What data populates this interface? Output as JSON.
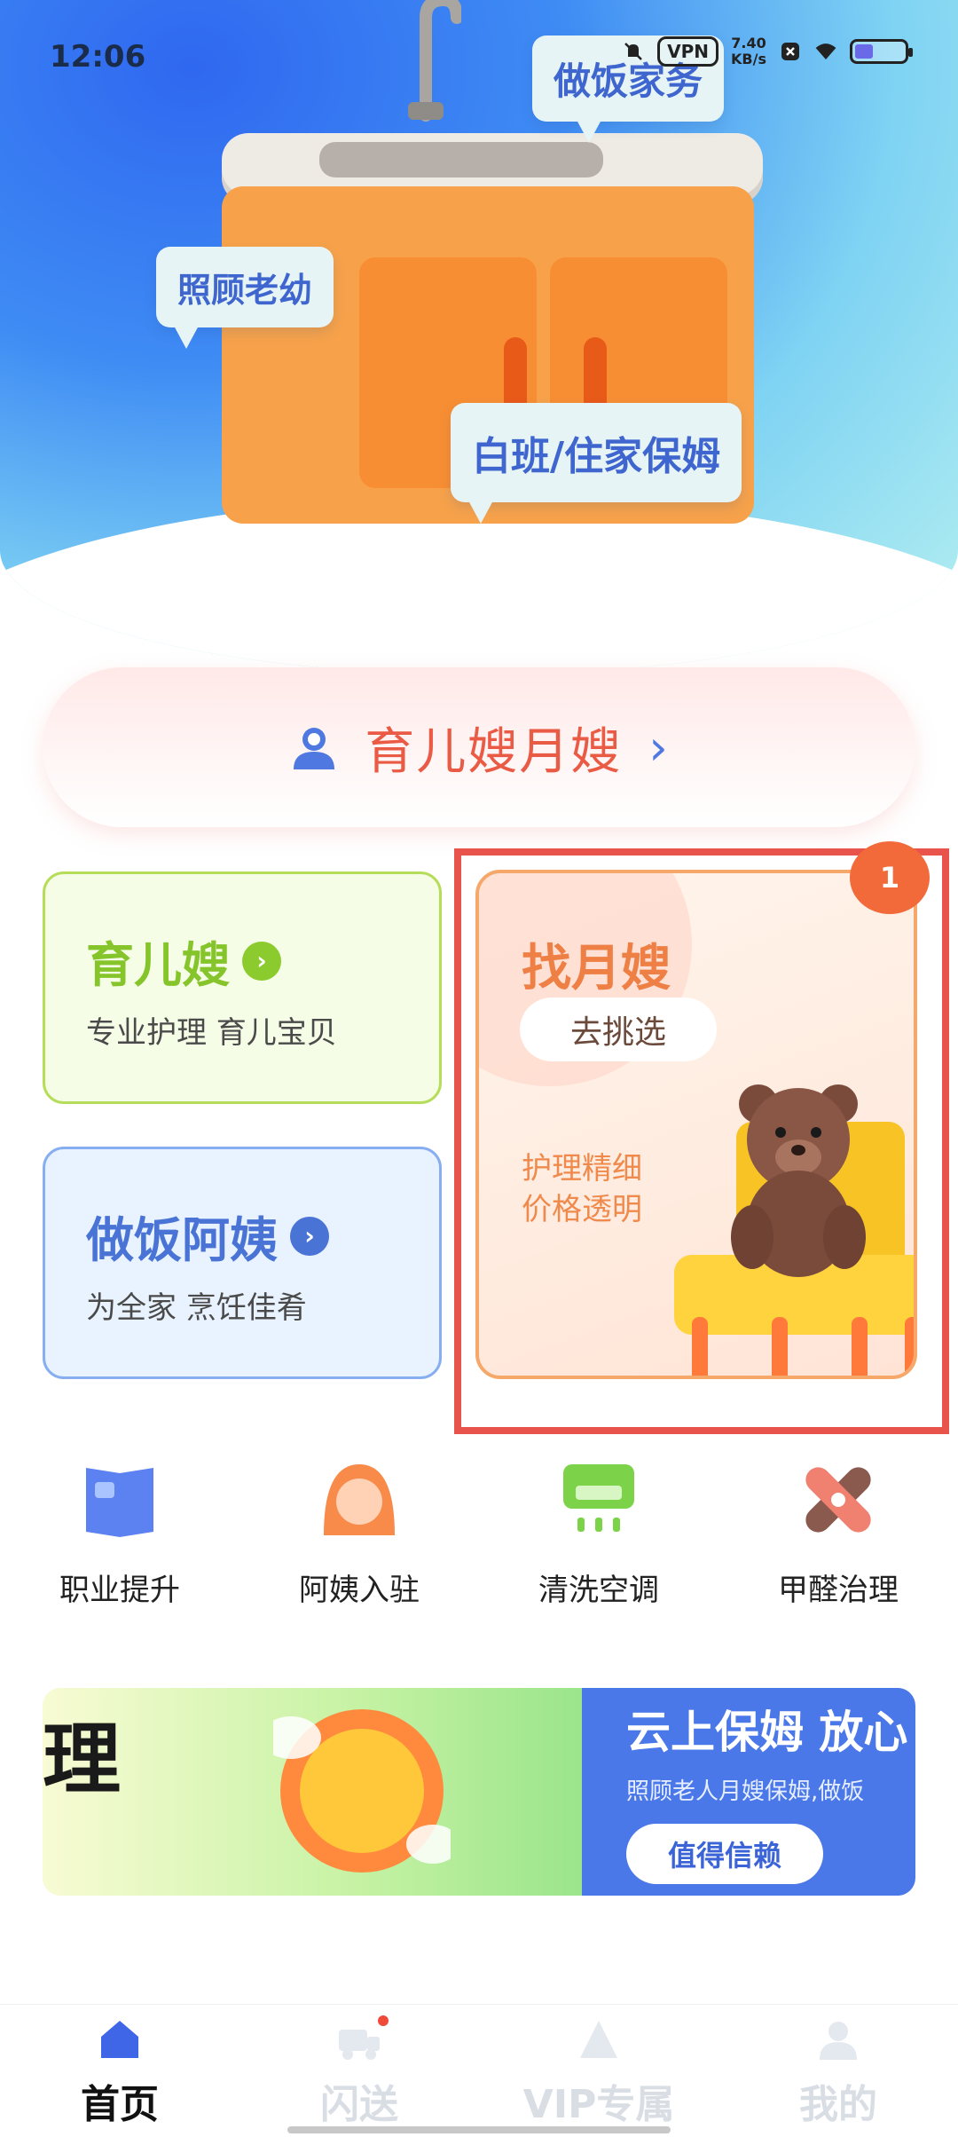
{
  "status_bar": {
    "time": "12:06",
    "vpn": "VPN",
    "net_speed_value": "7.40",
    "net_speed_unit": "KB/s"
  },
  "hero": {
    "bubbles": [
      "做饭家务",
      "照顾老幼",
      "白班/住家保姆"
    ]
  },
  "main_pill": {
    "label": "育儿嫂月嫂",
    "icon": "person-icon",
    "chevron": "›"
  },
  "cards": {
    "nanny": {
      "title": "育儿嫂",
      "subtitle": "专业护理 育儿宝贝"
    },
    "cook": {
      "title": "做饭阿姨",
      "subtitle": "为全家 烹饪佳肴"
    },
    "yuesao": {
      "title": "找月嫂",
      "button": "去挑选",
      "desc_line1": "护理精细",
      "desc_line2": "价格透明",
      "badge": "1"
    }
  },
  "services": [
    {
      "label": "职业提升",
      "icon": "book-icon"
    },
    {
      "label": "阿姨入驻",
      "icon": "auntie-icon"
    },
    {
      "label": "清洗空调",
      "icon": "air-conditioner-icon"
    },
    {
      "label": "甲醛治理",
      "icon": "bandage-icon"
    }
  ],
  "banner": {
    "left_text": "理",
    "title": "云上保姆 放心",
    "subtitle": "照顾老人月嫂保姆,做饭",
    "button": "值得信赖"
  },
  "bottom_nav": [
    {
      "label": "首页",
      "icon": "home-icon",
      "active": true
    },
    {
      "label": "闪送",
      "icon": "truck-icon",
      "active": false
    },
    {
      "label": "VIP专属",
      "icon": "vip-icon",
      "active": false
    },
    {
      "label": "我的",
      "icon": "user-icon",
      "active": false
    }
  ],
  "colors": {
    "accent_blue": "#4a73d6",
    "accent_orange": "#ea5b45",
    "nanny_green": "#85c52b",
    "highlight_red": "#e8544c"
  }
}
